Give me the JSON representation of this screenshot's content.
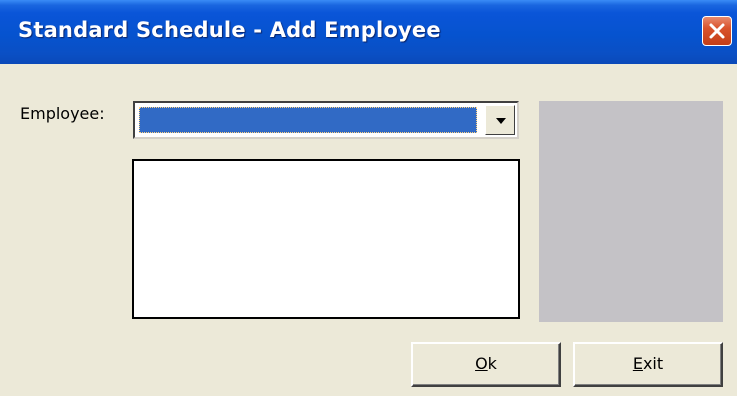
{
  "window": {
    "title": "Standard Schedule - Add Employee"
  },
  "titlebar": {
    "close_icon": "close-x-icon"
  },
  "form": {
    "employee_label": "Employee:",
    "employee_selected_value": "",
    "dropdown_icon": "chevron-down-icon"
  },
  "buttons": {
    "ok": {
      "mnemonic": "O",
      "rest": "k"
    },
    "exit": {
      "mnemonic": "E",
      "rest": "xit"
    }
  },
  "colors": {
    "titlebar": "#0a55d8",
    "selection_highlight": "#316ac5",
    "close_button": "#d9532c",
    "dialog_background": "#ece9d8",
    "preview_panel": "#c4c2c6"
  }
}
